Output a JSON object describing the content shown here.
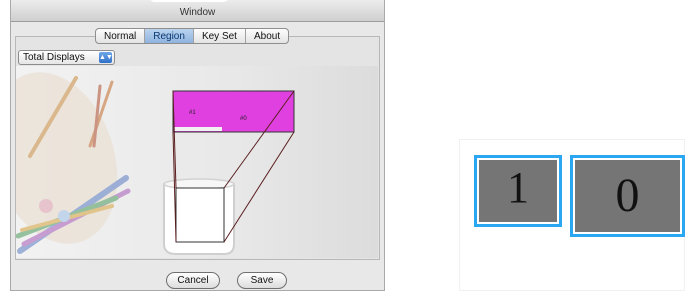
{
  "window": {
    "title": "Window"
  },
  "tabs": [
    {
      "label": "Normal",
      "selected": false
    },
    {
      "label": "Region",
      "selected": true
    },
    {
      "label": "Key Set",
      "selected": false
    },
    {
      "label": "About",
      "selected": false
    }
  ],
  "display_popup": {
    "selected": "Total Displays"
  },
  "region": {
    "fill_color": "#e040e0",
    "labels": [
      "#1",
      "#0"
    ]
  },
  "buttons": {
    "cancel": "Cancel",
    "save": "Save"
  },
  "displays": [
    {
      "label": "1"
    },
    {
      "label": "0"
    }
  ],
  "colors": {
    "display_border": "#2aa7f0",
    "display_fill": "#757575",
    "tab_selected": "#8fb3de"
  }
}
